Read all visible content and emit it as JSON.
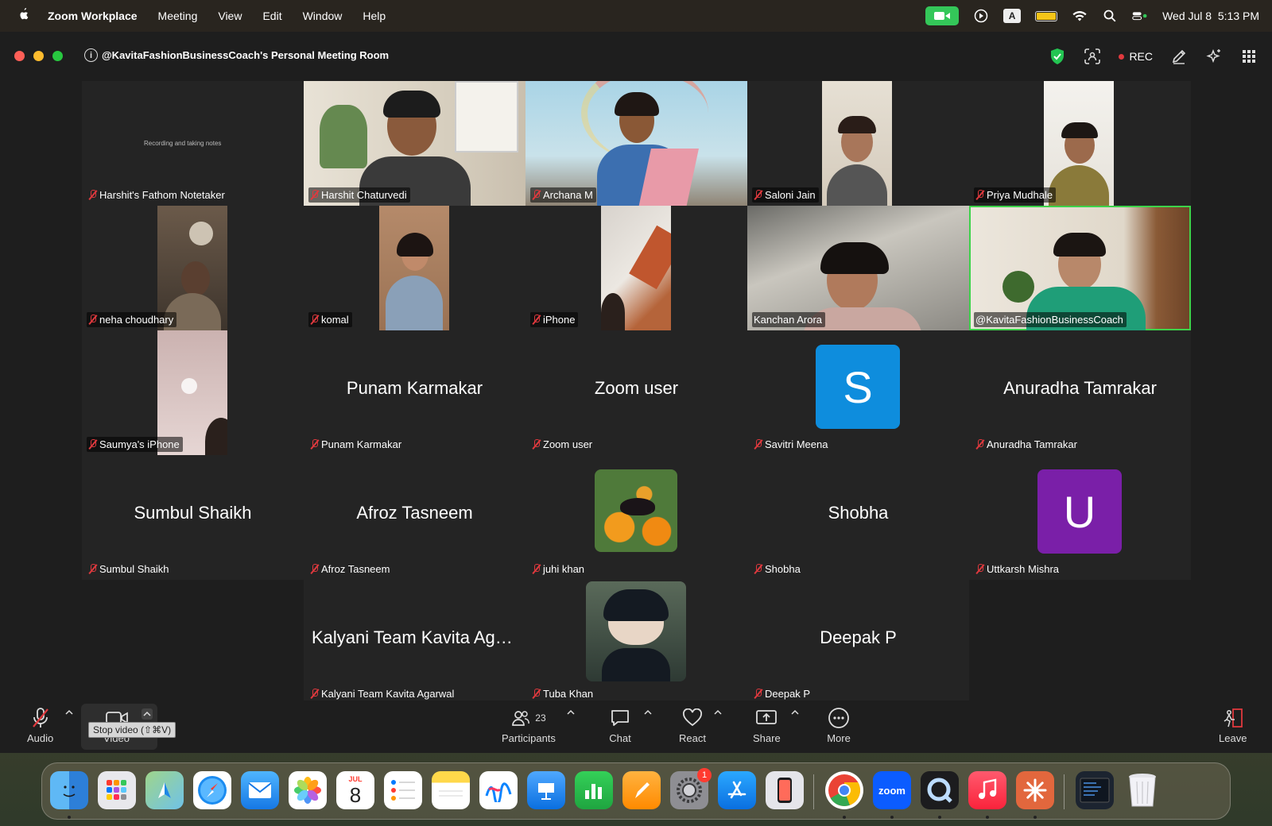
{
  "menubar": {
    "app_name": "Zoom Workplace",
    "menus": [
      "Meeting",
      "View",
      "Edit",
      "Window",
      "Help"
    ],
    "date_time": "Wed Jul 8  5:13 PM",
    "input_indicator": "A"
  },
  "window": {
    "title": "@KavitaFashionBusinessCoach's Personal Meeting Room",
    "info_glyph": "i",
    "rec_label": "REC"
  },
  "participants": [
    {
      "name": "Harshit's Fathom Notetaker",
      "display": "video",
      "caption": "Recording and taking notes"
    },
    {
      "name": "Harshit Chaturvedi",
      "display": "video"
    },
    {
      "name": "Archana M",
      "display": "video"
    },
    {
      "name": "Saloni Jain",
      "display": "video"
    },
    {
      "name": "Priya Mudhale",
      "display": "video"
    },
    {
      "name": "neha choudhary",
      "display": "video"
    },
    {
      "name": "komal",
      "display": "video"
    },
    {
      "name": "iPhone",
      "display": "video"
    },
    {
      "name": "Kanchan Arora",
      "display": "video",
      "muted": false
    },
    {
      "name": "@KavitaFashionBusinessCoach",
      "display": "video",
      "muted": false,
      "active_speaker": true
    },
    {
      "name": "Saumya's iPhone",
      "display": "video"
    },
    {
      "name": "Punam Karmakar",
      "display": "name",
      "big_name": "Punam Karmakar"
    },
    {
      "name": "Zoom user",
      "display": "name",
      "big_name": "Zoom user"
    },
    {
      "name": "Savitri Meena",
      "display": "avatar",
      "avatar_letter": "S",
      "avatar_color": "#0e8ddd"
    },
    {
      "name": "Anuradha Tamrakar",
      "display": "name",
      "big_name": "Anuradha Tamrakar"
    },
    {
      "name": "Sumbul Shaikh",
      "display": "name",
      "big_name": "Sumbul Shaikh"
    },
    {
      "name": "Afroz Tasneem",
      "display": "name",
      "big_name": "Afroz Tasneem"
    },
    {
      "name": "juhi khan",
      "display": "photo"
    },
    {
      "name": "Shobha",
      "display": "name",
      "big_name": "Shobha"
    },
    {
      "name": "Uttkarsh Mishra",
      "display": "avatar",
      "avatar_letter": "U",
      "avatar_color": "#7a1fa8"
    },
    {
      "name": "Kalyani Team Kavita Agarwal",
      "display": "name",
      "big_name": "Kalyani Team Kavita Aga..."
    },
    {
      "name": "Tuba Khan",
      "display": "photo"
    },
    {
      "name": "Deepak P",
      "display": "name",
      "big_name": "Deepak P"
    }
  ],
  "toolbar": {
    "audio_label": "Audio",
    "video_label": "Video",
    "video_tooltip": "Stop video (⇧⌘V)",
    "participants_label": "Participants",
    "participants_count": "23",
    "chat_label": "Chat",
    "react_label": "React",
    "share_label": "Share",
    "more_label": "More",
    "leave_label": "Leave"
  },
  "dock": {
    "items": [
      "finder-icon",
      "launchpad-icon",
      "maps-icon",
      "safari-icon",
      "mail-icon",
      "photos-icon",
      "calendar-icon",
      "reminders-icon",
      "notes-icon",
      "freeform-icon",
      "keynote-icon",
      "numbers-icon",
      "pages-icon",
      "system-settings-icon",
      "app-store-icon",
      "iphone-mirroring-icon",
      "chrome-icon",
      "zoom-icon",
      "quicktime-icon",
      "music-icon",
      "claude-icon",
      "screenshot-icon",
      "trash-icon"
    ],
    "calendar_month": "JUL",
    "calendar_day": "8",
    "settings_badge": "1",
    "zoom_label": "zoom"
  },
  "colors": {
    "active_speaker_border": "#3dd34a",
    "mute_red": "#e0393e",
    "window_bg": "#1e1e1e",
    "tile_bg": "#242424"
  }
}
